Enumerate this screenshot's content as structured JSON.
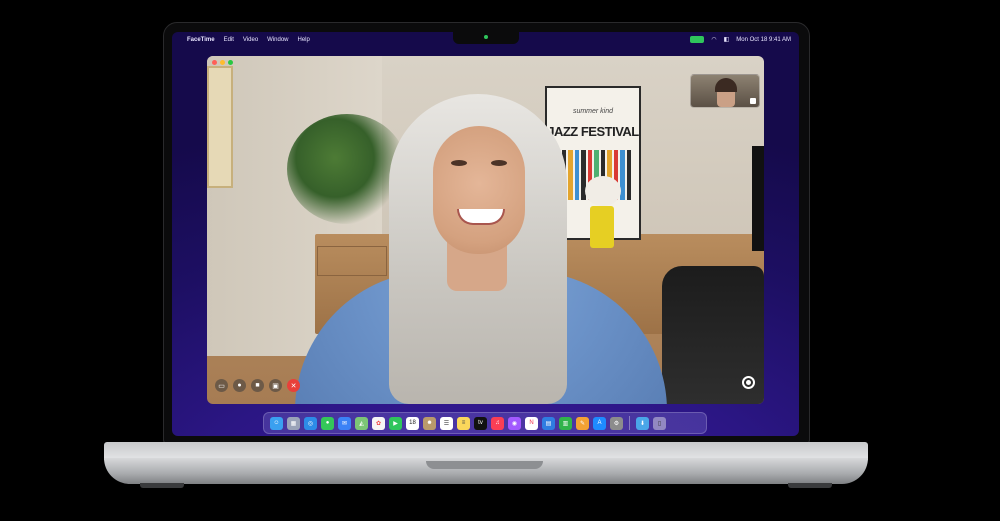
{
  "menubar": {
    "app_name": "FaceTime",
    "menus": [
      "Edit",
      "Video",
      "Window",
      "Help"
    ],
    "datetime": "Mon Oct 18  9:41 AM"
  },
  "poster": {
    "subtitle": "summer kind",
    "title": "JAZZ FESTIVAL"
  },
  "calendar_day": "18",
  "apple_tv_label": "tv",
  "colors": {
    "camera_indicator": "#2fc55c",
    "end_call": "#e8403a",
    "dock_tint": "#7a6ecc"
  },
  "controls": [
    "sidebar-icon",
    "microphone-icon",
    "video-camera-icon",
    "screen-share-icon",
    "end-call-icon"
  ],
  "dock_icons": [
    "finder",
    "launchpad",
    "safari",
    "messages",
    "mail",
    "maps",
    "photos",
    "facetime",
    "calendar",
    "contacts",
    "reminders",
    "notes",
    "apple-tv",
    "music",
    "podcasts",
    "news",
    "keynote",
    "numbers",
    "pages",
    "app-store",
    "system-preferences",
    "downloads",
    "trash"
  ]
}
